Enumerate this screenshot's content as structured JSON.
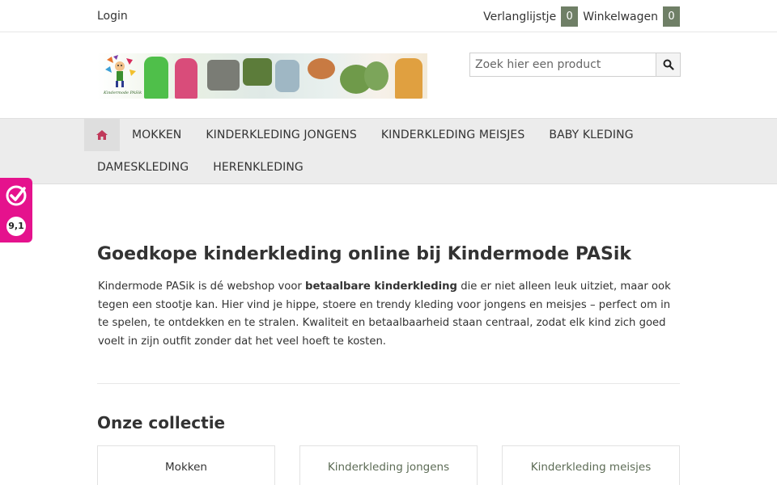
{
  "topbar": {
    "login": "Login",
    "wishlist_label": "Verlanglijstje",
    "wishlist_count": "0",
    "cart_label": "Winkelwagen",
    "cart_count": "0"
  },
  "header": {
    "banner_logo_text": "Kindermode PASik",
    "search_placeholder": "Zoek hier een product",
    "search_icon": "search-icon"
  },
  "nav": {
    "home_icon": "home-icon",
    "row1": [
      "MOKKEN",
      "KINDERKLEDING JONGENS",
      "KINDERKLEDING MEISJES",
      "BABY KLEDING"
    ],
    "row2": [
      "DAMESKLEDING",
      "HERENKLEDING"
    ]
  },
  "rating": {
    "score": "9,1",
    "icon": "checkmark-badge-icon"
  },
  "main": {
    "title": "Goedkope kinderkleding online bij Kindermode PASik",
    "intro_before": "Kindermode PASik is dé webshop voor ",
    "intro_bold": "betaalbare kinderkleding",
    "intro_after": " die er niet alleen leuk uitziet, maar ook tegen een stootje kan. Hier vind je hippe, stoere en trendy kleding voor jongens en meisjes – perfect om in te spelen, te ontdekken en te stralen. Kwaliteit en betaalbaarheid staan centraal, zodat elk kind zich goed voelt in zijn outfit zonder dat het veel hoeft te kosten.",
    "collection_title": "Onze collectie",
    "collection": [
      "Mokken",
      "Kinderkleding jongens",
      "Kinderkleding meisjes"
    ]
  },
  "colors": {
    "badge": "#6f7f66",
    "rating_bg": "#e5128d",
    "home_icon": "#c0395a",
    "nav_bg": "#ececec"
  }
}
